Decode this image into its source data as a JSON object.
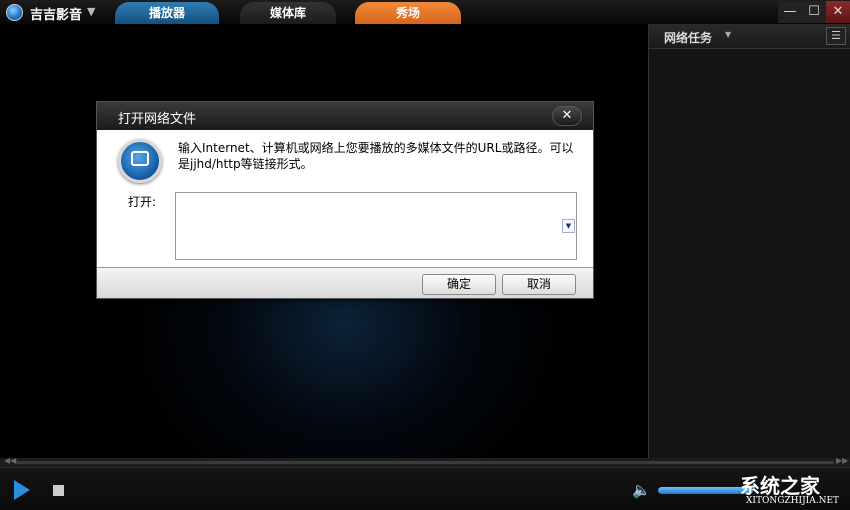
{
  "app": {
    "name": "吉吉影音",
    "tabs": [
      {
        "label": "播放器"
      },
      {
        "label": "媒体库"
      },
      {
        "label": "秀场"
      }
    ],
    "window_controls": {
      "minimize": "—",
      "maximize": "☐",
      "close": "✕"
    }
  },
  "side_panel": {
    "title": "网络任务"
  },
  "dialog": {
    "title": "打开网络文件",
    "message": "输入Internet、计算机或网络上您要播放的多媒体文件的URL或路径。可以是jjhd/http等链接形式。",
    "open_label": "打开:",
    "input_value": "",
    "ok_label": "确定",
    "cancel_label": "取消"
  },
  "player": {
    "volume_percent": 75
  },
  "watermark": {
    "title": "系统之家",
    "url": "XITONGZHIJIA.NET"
  },
  "colors": {
    "accent": "#2a8fdc",
    "showcase": "#e8782a"
  }
}
